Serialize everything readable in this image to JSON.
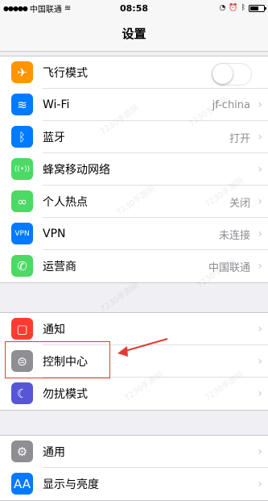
{
  "status_bar": {
    "carrier": "中国联通",
    "time": "08:58"
  },
  "nav": {
    "title": "设置"
  },
  "groups": [
    {
      "rows": [
        {
          "label": "飞行模式",
          "icon": "airplane-icon",
          "color": "#ff9500",
          "glyph": "✈",
          "control": "toggle",
          "toggle_on": false
        },
        {
          "label": "Wi-Fi",
          "icon": "wifi-icon",
          "color": "#007aff",
          "glyph": "≋",
          "value": "jf-china"
        },
        {
          "label": "蓝牙",
          "icon": "bluetooth-icon",
          "color": "#007aff",
          "glyph": "ᛒ",
          "value": "打开"
        },
        {
          "label": "蜂窝移动网络",
          "icon": "cellular-icon",
          "color": "#4cd964",
          "glyph": "((•))"
        },
        {
          "label": "个人热点",
          "icon": "hotspot-icon",
          "color": "#4cd964",
          "glyph": "∞",
          "value": "关闭"
        },
        {
          "label": "VPN",
          "icon": "vpn-icon",
          "color": "#007aff",
          "glyph": "VPN",
          "value": "未连接"
        },
        {
          "label": "运营商",
          "icon": "phone-icon",
          "color": "#4cd964",
          "glyph": "✆",
          "value": "中国联通"
        }
      ]
    },
    {
      "rows": [
        {
          "label": "通知",
          "icon": "notification-icon",
          "color": "#ff3b30",
          "glyph": "▢"
        },
        {
          "label": "控制中心",
          "icon": "control-center-icon",
          "color": "#8e8e93",
          "glyph": "⊜"
        },
        {
          "label": "勿扰模式",
          "icon": "moon-icon",
          "color": "#5856d6",
          "glyph": "☾"
        }
      ]
    },
    {
      "rows": [
        {
          "label": "通用",
          "icon": "gear-icon",
          "color": "#8e8e93",
          "glyph": "⚙"
        },
        {
          "label": "显示与亮度",
          "icon": "display-icon",
          "color": "#007aff",
          "glyph": "AA"
        }
      ]
    }
  ],
  "watermark_text": "7230手游网",
  "annotation_color": "#e53935"
}
